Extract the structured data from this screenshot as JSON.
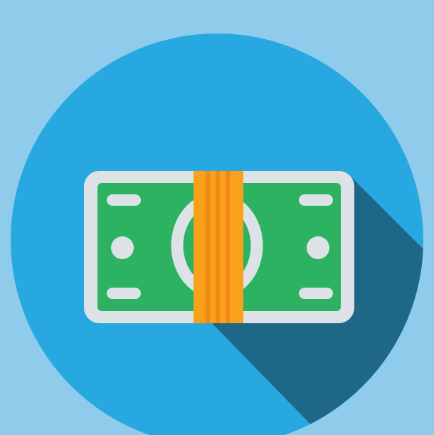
{
  "icon": {
    "name": "money-bill-icon",
    "band_name": "money-band-icon"
  },
  "colors": {
    "page_background": "#8fcbea",
    "circle": "#27a8e1",
    "long_shadow": "#1e6786",
    "bill_border": "#dde2e7",
    "bill_face": "#2db262",
    "bill_detail": "#dde2e7",
    "band_light": "#f9a11b",
    "band_dark": "#ef8a12"
  }
}
